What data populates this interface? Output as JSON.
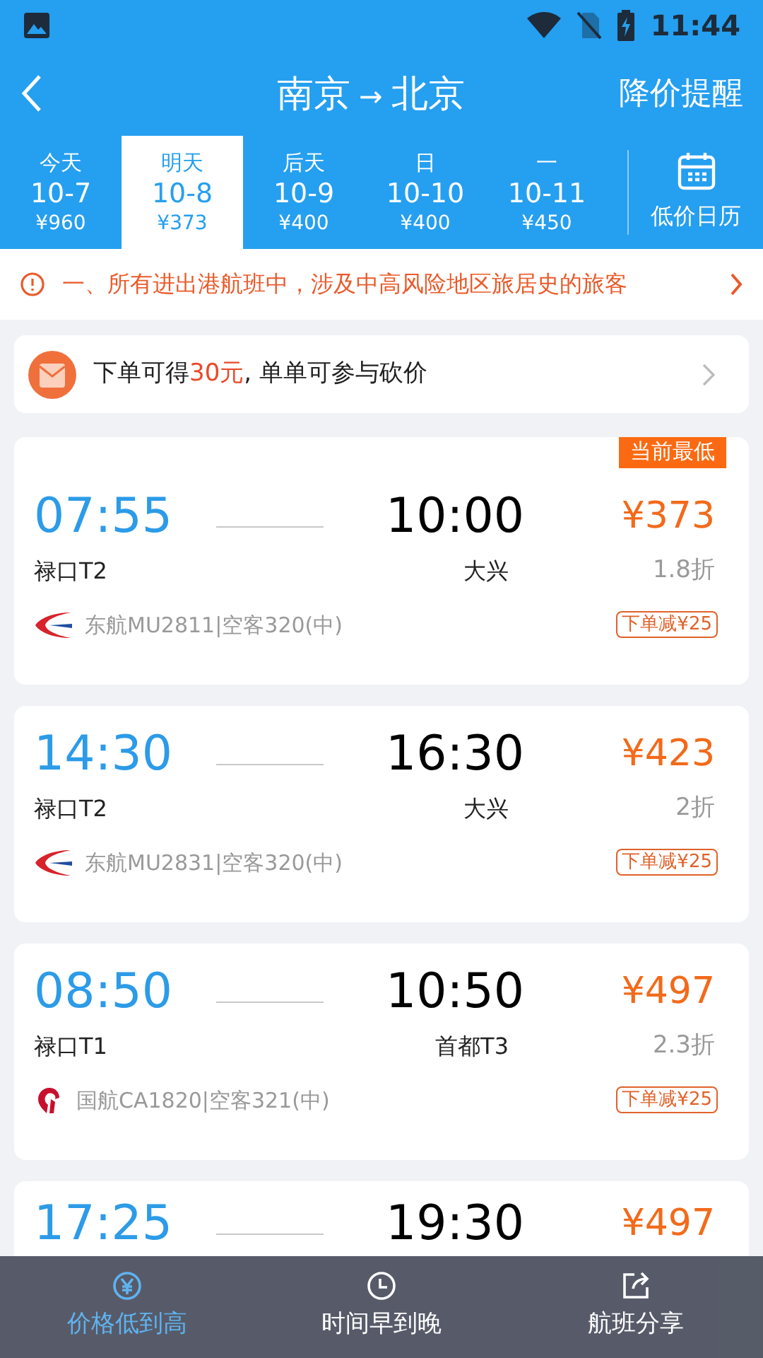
{
  "status_bar": {
    "time": "11:44"
  },
  "header": {
    "from": "南京",
    "arrow": "→",
    "to": "北京",
    "action": "降价提醒"
  },
  "dates": [
    {
      "weekday": "今天",
      "date": "10-7",
      "price": "¥960",
      "selected": false
    },
    {
      "weekday": "明天",
      "date": "10-8",
      "price": "¥373",
      "selected": true
    },
    {
      "weekday": "后天",
      "date": "10-9",
      "price": "¥400",
      "selected": false
    },
    {
      "weekday": "日",
      "date": "10-10",
      "price": "¥400",
      "selected": false
    },
    {
      "weekday": "一",
      "date": "10-11",
      "price": "¥450",
      "selected": false
    }
  ],
  "calendar": {
    "label": "低价日历"
  },
  "notice": {
    "text": "一、所有进出港航班中，涉及中高风险地区旅居史的旅客"
  },
  "promo": {
    "text": "下单可得**30元**, 单单可参与砍价"
  },
  "flights": [
    {
      "kind": "eastern",
      "dep_time": "07:55",
      "arr_time": "10:00",
      "dep_airport": "禄口T2",
      "arr_airport": "大兴",
      "price": "¥373",
      "discount": "1.8折",
      "airline": "东航MU2811|空客320(中)",
      "coupon": "下单减¥25",
      "badge": "当前最低"
    },
    {
      "kind": "eastern",
      "dep_time": "14:30",
      "arr_time": "16:30",
      "dep_airport": "禄口T2",
      "arr_airport": "大兴",
      "price": "¥423",
      "discount": "2折",
      "airline": "东航MU2831|空客320(中)",
      "coupon": "下单减¥25"
    },
    {
      "kind": "airchina",
      "dep_time": "08:50",
      "arr_time": "10:50",
      "dep_airport": "禄口T1",
      "arr_airport": "首都T3",
      "price": "¥497",
      "discount": "2.3折",
      "airline": "国航CA1820|空客321(中)",
      "coupon": "下单减¥25"
    },
    {
      "dep_time": "17:25",
      "arr_time": "19:30",
      "price": "¥497"
    }
  ],
  "sort_bar": [
    {
      "kind": "price",
      "label": "价格低到高",
      "selected": true
    },
    {
      "kind": "time",
      "label": "时间早到晚",
      "selected": false
    },
    {
      "kind": "share",
      "label": "航班分享",
      "selected": false
    }
  ]
}
